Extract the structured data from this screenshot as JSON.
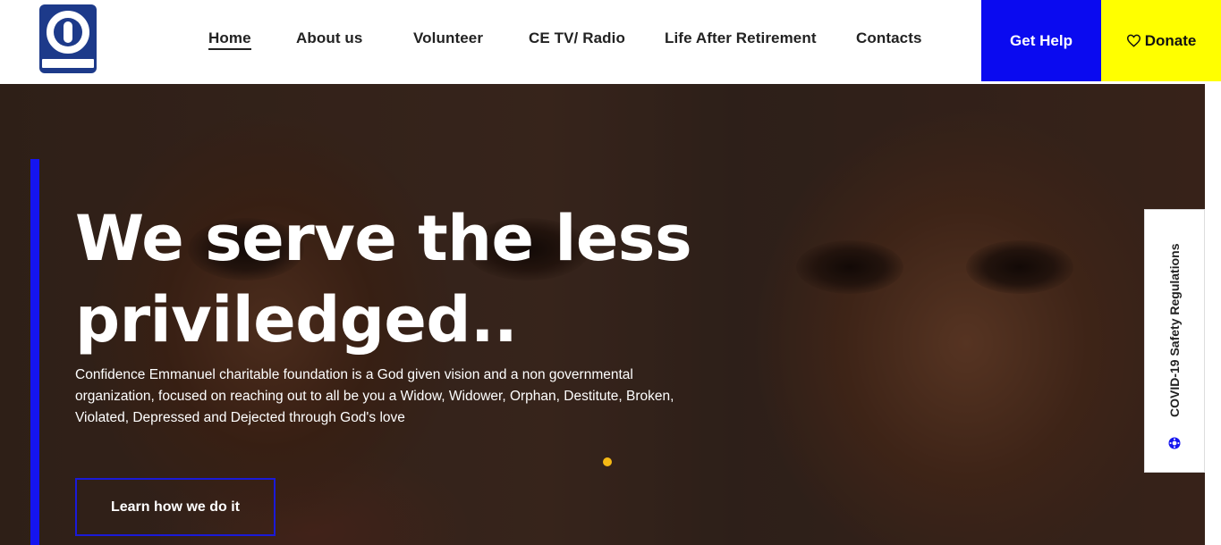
{
  "brand": {
    "logo_name": "Confidence Emmanuel Charitable Foundation logo"
  },
  "nav": {
    "items": [
      {
        "label": "Home",
        "active": true
      },
      {
        "label": "About us"
      },
      {
        "label": "Volunteer"
      },
      {
        "label": "CE TV/ Radio"
      },
      {
        "label": "Life After Retirement"
      },
      {
        "label": "Contacts"
      }
    ]
  },
  "actions": {
    "get_help": "Get Help",
    "donate": "Donate",
    "donate_icon": "heart-icon",
    "get_help_color": "#0a0af0",
    "donate_color": "#ffff00"
  },
  "hero": {
    "title": "We serve the less priviledged..",
    "description": "Confidence Emmanuel charitable foundation is a God given vision and a non governmental organization, focused on reaching out to all be you a Widow, Widower, Orphan, Destitute, Broken, Violated, Depressed and Dejected through God's love",
    "cta": "Learn how we do it",
    "accent_color": "#1515f0",
    "slider_dot_color": "#f5b915"
  },
  "side_tab": {
    "label": "COVID-19 Safety Regulations",
    "icon": "virus-icon"
  }
}
